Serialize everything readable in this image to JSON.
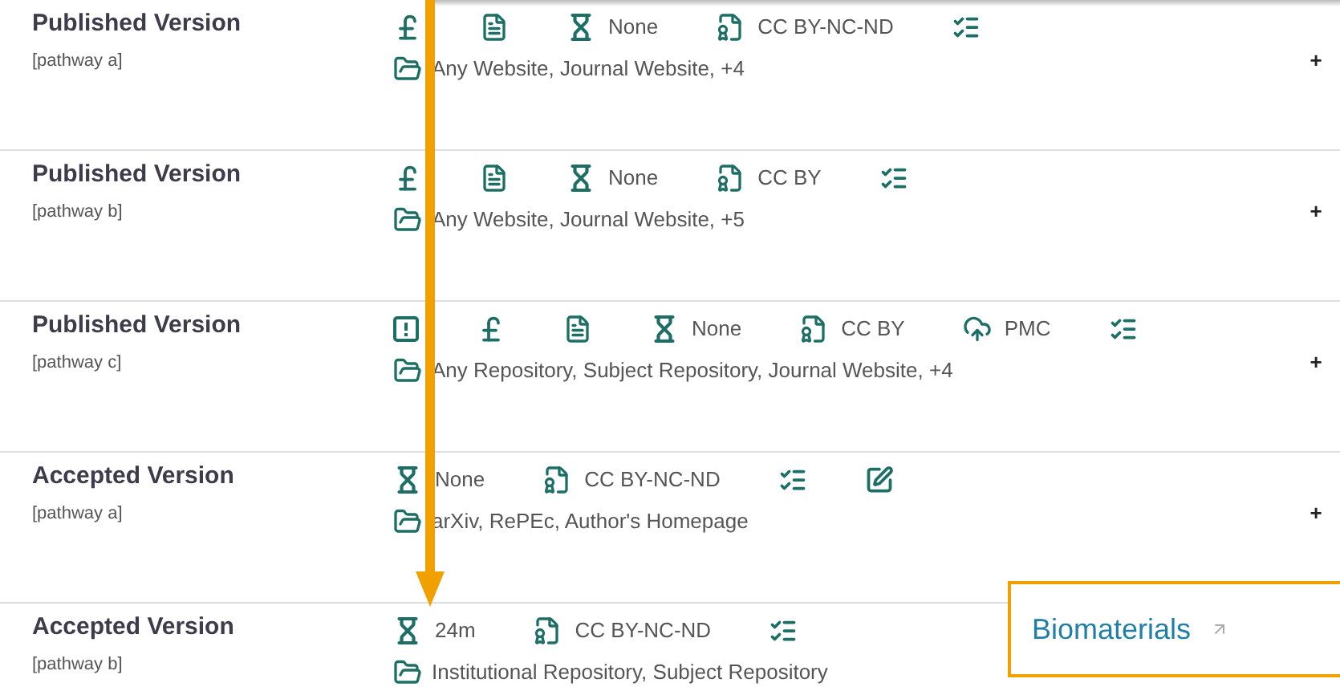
{
  "pathways": [
    {
      "version": "Published Version",
      "pathway": "[pathway a]",
      "items": [
        {
          "kind": "fee"
        },
        {
          "kind": "copy"
        },
        {
          "kind": "embargo",
          "text": "None"
        },
        {
          "kind": "license",
          "text": "CC BY-NC-ND"
        },
        {
          "kind": "conditions"
        }
      ],
      "locations": "Any Website, Journal Website, +4",
      "toggle": "+"
    },
    {
      "version": "Published Version",
      "pathway": "[pathway b]",
      "items": [
        {
          "kind": "fee"
        },
        {
          "kind": "copy"
        },
        {
          "kind": "embargo",
          "text": "None"
        },
        {
          "kind": "license",
          "text": "CC BY"
        },
        {
          "kind": "conditions"
        }
      ],
      "locations": "Any Website, Journal Website, +5",
      "toggle": "+"
    },
    {
      "version": "Published Version",
      "pathway": "[pathway c]",
      "items": [
        {
          "kind": "prerequisite"
        },
        {
          "kind": "fee"
        },
        {
          "kind": "copy"
        },
        {
          "kind": "embargo",
          "text": "None"
        },
        {
          "kind": "license",
          "text": "CC BY"
        },
        {
          "kind": "deposit",
          "text": "PMC"
        },
        {
          "kind": "conditions"
        }
      ],
      "locations": "Any Repository, Subject Repository, Journal Website, +4",
      "toggle": "+"
    },
    {
      "version": "Accepted Version",
      "pathway": "[pathway a]",
      "items": [
        {
          "kind": "embargo",
          "text": "None"
        },
        {
          "kind": "license",
          "text": "CC BY-NC-ND"
        },
        {
          "kind": "conditions"
        },
        {
          "kind": "edit"
        }
      ],
      "locations": "arXiv, RePEc, Author's Homepage",
      "toggle": "+"
    },
    {
      "version": "Accepted Version",
      "pathway": "[pathway b]",
      "items": [
        {
          "kind": "embargo",
          "text": "24m"
        },
        {
          "kind": "license",
          "text": "CC BY-NC-ND"
        },
        {
          "kind": "conditions"
        }
      ],
      "locations": "Institutional Repository, Subject Repository"
    }
  ],
  "journal_link": {
    "label": "Biomaterials"
  }
}
